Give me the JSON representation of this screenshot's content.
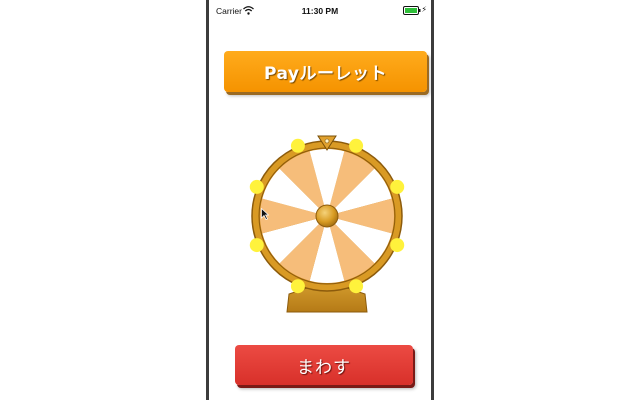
{
  "status_bar": {
    "carrier": "Carrier",
    "time": "11:30 PM",
    "icons": [
      "wifi-icon",
      "battery-icon",
      "charging-icon"
    ]
  },
  "title": "Payルーレット",
  "spin_button": {
    "label": "まわす"
  },
  "roulette": {
    "segment_count": 12,
    "pointer": "pointer-icon",
    "light_count": 8
  },
  "colors": {
    "title_bg": "#f7a10c",
    "button_bg": "#e23a33",
    "wheel_rim": "#d79a26",
    "segment_orange": "#f6bd7a",
    "segment_white": "#ffffff",
    "lights": "#fff23c"
  }
}
